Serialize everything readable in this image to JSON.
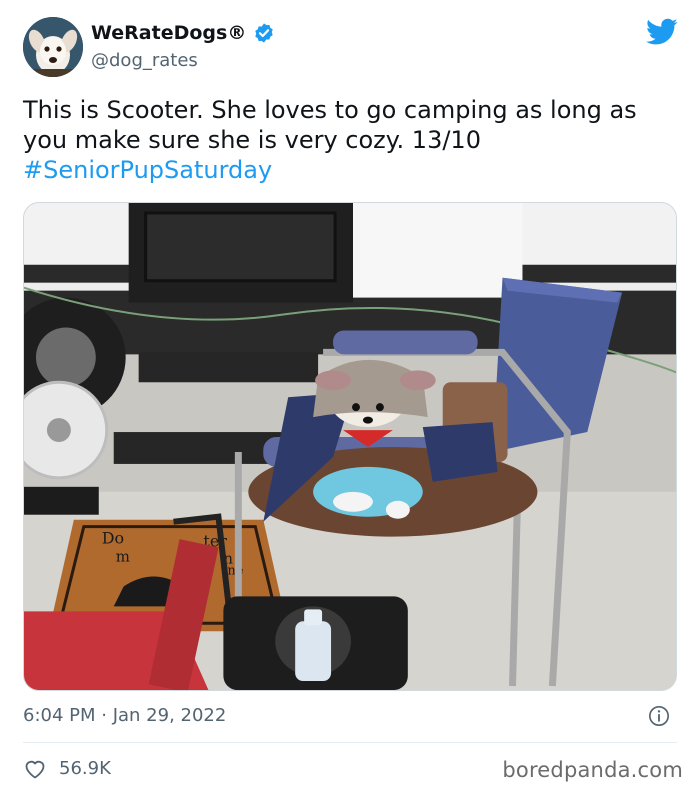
{
  "author": {
    "display_name": "WeRateDogs®",
    "handle": "@dog_rates",
    "verified": true,
    "avatar_icon": "dog-avatar-icon"
  },
  "tweet": {
    "text_lines": [
      "This is Scooter. She loves to go camping as long as",
      "you make sure she is very cozy. 13/10"
    ],
    "hashtag": "#SeniorPupSaturday",
    "photo_sign_text": [
      "Do",
      "ter",
      "m",
      "n",
      "ne"
    ]
  },
  "meta": {
    "timestamp": "6:04 PM · Jan 29, 2022"
  },
  "actions": {
    "like_count": "56.9K"
  },
  "watermark": "boredpanda.com",
  "colors": {
    "link": "#1d9bf0",
    "verified": "#1d9bf0",
    "secondary_text": "#536471"
  }
}
